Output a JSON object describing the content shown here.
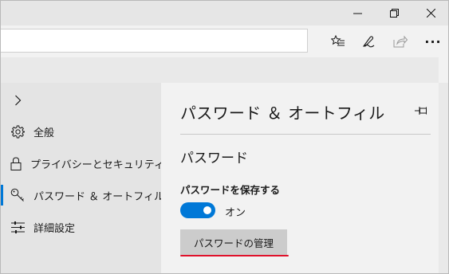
{
  "window": {
    "controls": [
      "minimize-icon",
      "maximize-icon",
      "close-icon"
    ]
  },
  "toolbar": {
    "address_value": "",
    "icons": [
      "favorites-bar-icon",
      "notes-icon",
      "share-icon",
      "more-icon"
    ],
    "more_label": "···"
  },
  "sidebar": {
    "collapse_icon": "chevron-right-icon",
    "items": [
      {
        "label": "全般",
        "icon": "gear-icon"
      },
      {
        "label": "プライバシーとセキュリティ",
        "icon": "lock-icon"
      },
      {
        "label": "パスワード ＆ オートフィル",
        "icon": "key-icon",
        "active": true
      },
      {
        "label": "詳細設定",
        "icon": "sliders-icon"
      }
    ]
  },
  "panel": {
    "title": "パスワード ＆ オートフィル",
    "pin_icon": "pin-icon",
    "section_title": "パスワード",
    "save_label": "パスワードを保存する",
    "save_toggle_state": "オン",
    "manage_button": "パスワードの管理"
  },
  "colors": {
    "accent": "#0078d7",
    "highlight_underline": "#e0112b"
  }
}
